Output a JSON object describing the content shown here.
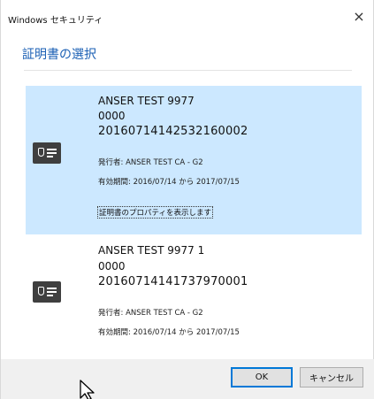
{
  "window": {
    "title": "Windows セキュリティ",
    "close_glyph": "×"
  },
  "dialog": {
    "heading": "証明書の選択"
  },
  "certificates": [
    {
      "name": "ANSER TEST 9977",
      "serial": "0000",
      "id": "20160714142532160002",
      "issuer": "発行者: ANSER TEST CA - G2",
      "validity": "有効期間: 2016/07/14 から 2017/07/15",
      "properties_link": "証明書のプロパティを表示します",
      "selected": true,
      "icon": "certificate-icon"
    },
    {
      "name": "ANSER TEST 9977 1",
      "serial": "0000",
      "id": "20160714141737970001",
      "issuer": "発行者: ANSER TEST CA - G2",
      "validity": "有効期間: 2016/07/14 から 2017/07/15",
      "selected": false,
      "icon": "certificate-icon"
    }
  ],
  "buttons": {
    "ok": "OK",
    "cancel": "キャンセル"
  },
  "colors": {
    "accent": "#1a5fb4",
    "selection": "#cce8ff",
    "footer": "#f0f0f0"
  }
}
